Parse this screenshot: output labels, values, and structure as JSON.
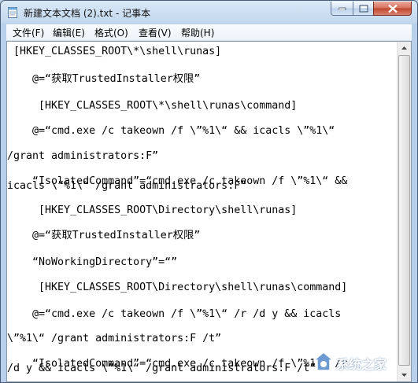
{
  "window": {
    "title": "新建文本文档 (2).txt - 记事本"
  },
  "menu": [
    "文件(F)",
    "编辑(E)",
    "格式(O)",
    "查看(V)",
    "帮助(H)"
  ],
  "lines": [
    " [HKEY_CLASSES_ROOT\\*\\shell\\runas]",
    "",
    "    @=“获取TrustedInstaller权限”",
    "",
    "     [HKEY_CLASSES_ROOT\\*\\shell\\runas\\command]",
    "",
    "    @=“cmd.exe /c takeown /f \\”%1\\“ && icacls \\”%1\\“",
    "/grant administrators:F”",
    "",
    "    “IsolatedCommand”=“cmd.exe /c takeown /f \\”%1\\“ &&",
    "icacls \\”%1\\“ /grant administrators:F”",
    "",
    "     [HKEY_CLASSES_ROOT\\Directory\\shell\\runas]",
    "",
    "    @=“获取TrustedInstaller权限”",
    "",
    "    “NoWorkingDirectory”=“”",
    "",
    "     [HKEY_CLASSES_ROOT\\Directory\\shell\\runas\\command]",
    "",
    "    @=“cmd.exe /c takeown /f \\”%1\\“ /r /d y && icacls",
    "\\”%1\\“ /grant administrators:F /t”",
    "",
    "    “IsolatedCommand”=“cmd.exe /c takeown /f \\”%1\\“ /r",
    "/d y && icacls \\”%1\\“ /grant administrators:F /t”"
  ],
  "watermark": {
    "text": "系统之家",
    "logo": "system-home-logo"
  }
}
